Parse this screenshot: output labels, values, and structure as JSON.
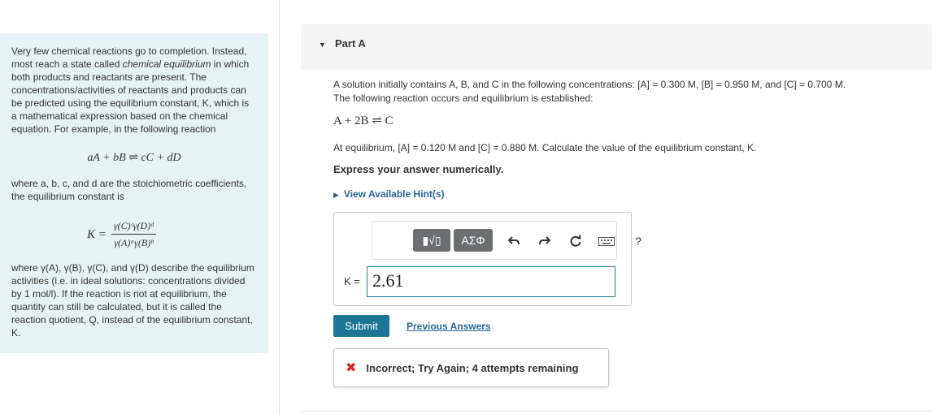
{
  "intro": {
    "p1_a": "Very few chemical reactions go to completion. Instead, most reach a state called ",
    "p1_em": "chemical equilibrium",
    "p1_b": " in which both products and reactants are present. The concentrations/activities of reactants and products can be predicted using the equilibrium constant, K, which is a mathematical expression based on the chemical equation. For example, in the following reaction",
    "general_equation": "aA + bB ⇌ cC + dD",
    "p2": "where a, b, c, and d are the stoichiometric coefficients, the equilibrium constant is",
    "k_lhs": "K =",
    "k_num": "γ(C)ᶜγ(D)ᵈ",
    "k_den": "γ(A)ᵃγ(B)ᵇ",
    "p3": "where γ(A), γ(B), γ(C), and γ(D) describe the equilibrium activities (i.e. in ideal solutions: concentrations divided by 1 mol/l). If the reaction is not at equilibrium, the quantity can still be calculated, but it is called the reaction quotient, Q, instead of the equilibrium constant, K."
  },
  "part": {
    "title": "Part A"
  },
  "question": {
    "line1": "A solution initially contains A, B, and C in the following concentrations: [A] = 0.300 M, [B] = 0.950 M, and [C] = 0.700 M.",
    "line2": "The following reaction occurs and equilibrium is established:",
    "reaction": "A + 2B ⇌ C",
    "line3": "At equilibrium, [A] = 0.120 M and [C] = 0.880 M. Calculate the value of the equilibrium constant, K.",
    "instruction": "Express your answer numerically.",
    "hints": "View Available Hint(s)"
  },
  "toolbar": {
    "templates_label": "▮√▯",
    "symbols_label": "ΑΣΦ",
    "help_label": "?"
  },
  "answer": {
    "label": "K =",
    "value": "2.61"
  },
  "actions": {
    "submit": "Submit",
    "previous": "Previous Answers"
  },
  "feedback": {
    "icon": "✖",
    "text": "Incorrect; Try Again; 4 attempts remaining"
  },
  "colors": {
    "intro_bg": "#e6f2f5",
    "submit_bg": "#1d7596",
    "link": "#2a6496",
    "error": "#d9261c"
  }
}
